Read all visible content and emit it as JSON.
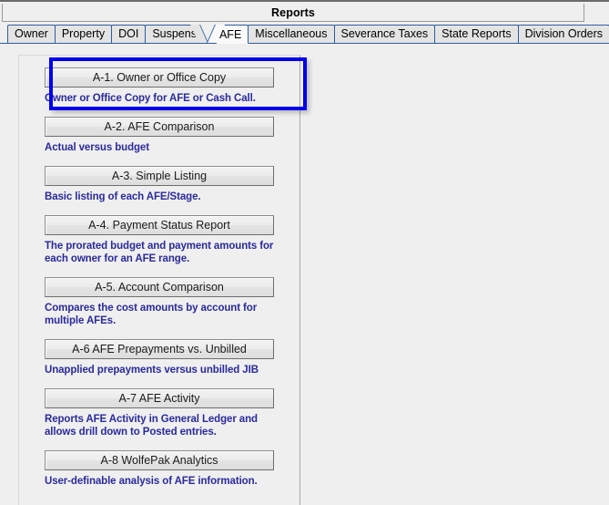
{
  "window": {
    "title": "Reports"
  },
  "tabs": [
    {
      "label": "Owner",
      "selected": false
    },
    {
      "label": "Property",
      "selected": false
    },
    {
      "label": "DOI",
      "selected": false
    },
    {
      "label": "Suspens",
      "selected": false
    },
    {
      "label": "AFE",
      "selected": true
    },
    {
      "label": "Miscellaneous",
      "selected": false
    },
    {
      "label": "Severance Taxes",
      "selected": false
    },
    {
      "label": "State Reports",
      "selected": false
    },
    {
      "label": "Division Orders",
      "selected": false
    }
  ],
  "reports": [
    {
      "button": "A-1. Owner or Office Copy",
      "description": "Owner or Office Copy for AFE or Cash Call.",
      "highlighted": true
    },
    {
      "button": "A-2. AFE Comparison",
      "description": "Actual versus budget",
      "highlighted": false
    },
    {
      "button": "A-3. Simple Listing",
      "description": "Basic listing of each AFE/Stage.",
      "highlighted": false
    },
    {
      "button": "A-4. Payment Status Report",
      "description": "The prorated budget and payment amounts for each owner for an AFE range.",
      "highlighted": false
    },
    {
      "button": "A-5. Account Comparison",
      "description": "Compares the cost amounts by account for multiple AFEs.",
      "highlighted": false
    },
    {
      "button": "A-6 AFE Prepayments vs. Unbilled",
      "description": "Unapplied prepayments versus unbilled JIB",
      "highlighted": false
    },
    {
      "button": "A-7 AFE Activity",
      "description": "Reports AFE Activity in General Ledger and allows drill down to Posted entries.",
      "highlighted": false
    },
    {
      "button": "A-8 WolfePak Analytics",
      "description": "User-definable analysis of AFE information.",
      "highlighted": false
    }
  ],
  "colors": {
    "highlight_border": "#0000EE",
    "description_text": "#2A2A9C",
    "tab_border": "#2F5D9E",
    "window_background": "#EFEFEF"
  }
}
